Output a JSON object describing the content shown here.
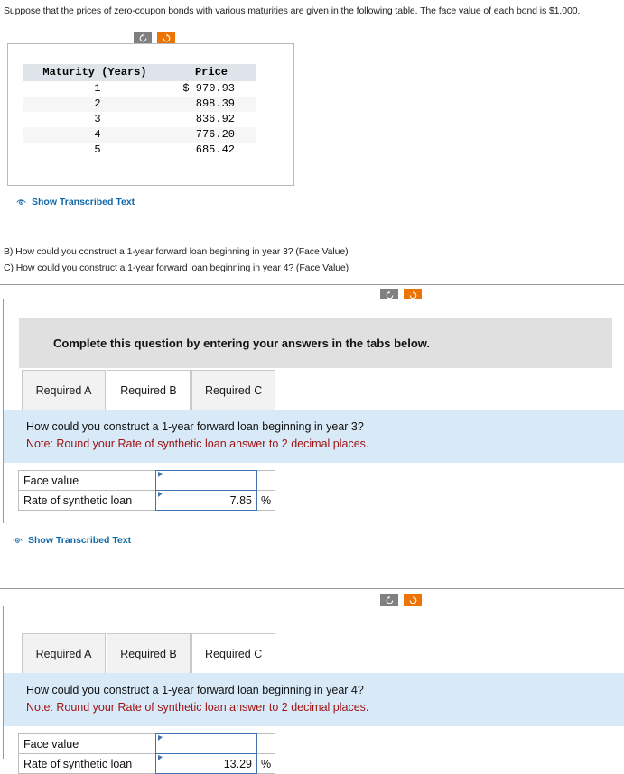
{
  "intro": {
    "text": "Suppose that the prices of zero-coupon bonds with various maturities are given in the following table. The face value of each bond is $1,000."
  },
  "toolbar": {
    "rotate_left_label": "rotate-left",
    "rotate_right_label": "rotate-right"
  },
  "bond_table": {
    "headers": [
      "Maturity (Years)",
      "Price"
    ],
    "rows": [
      {
        "maturity": "1",
        "price": "$ 970.93"
      },
      {
        "maturity": "2",
        "price": "898.39"
      },
      {
        "maturity": "3",
        "price": "836.92"
      },
      {
        "maturity": "4",
        "price": "776.20"
      },
      {
        "maturity": "5",
        "price": "685.42"
      }
    ]
  },
  "transcribed_link": {
    "label": "Show Transcribed Text"
  },
  "questions": {
    "b": "B) How could you construct a 1-year forward loan beginning in year 3? (Face Value)",
    "c": "C) How could you construct a 1-year forward loan beginning in year 4? (Face Value)"
  },
  "panel_b": {
    "banner": "Complete this question by entering your answers in the tabs below.",
    "tabs": [
      {
        "label": "Required A",
        "active": false
      },
      {
        "label": "Required B",
        "active": true
      },
      {
        "label": "Required C",
        "active": false
      }
    ],
    "question": "How could you construct a 1-year forward loan beginning in year 3?",
    "note": "Note: Round your Rate of synthetic loan answer to 2 decimal places.",
    "answers": [
      {
        "label": "Face value",
        "value": "",
        "unit": ""
      },
      {
        "label": "Rate of synthetic loan",
        "value": "7.85",
        "unit": "%"
      }
    ]
  },
  "panel_c": {
    "tabs": [
      {
        "label": "Required A",
        "active": false
      },
      {
        "label": "Required B",
        "active": false
      },
      {
        "label": "Required C",
        "active": true
      }
    ],
    "question": "How could you construct a 1-year forward loan beginning in year 4?",
    "note": "Note: Round your Rate of synthetic loan answer to 2 decimal places.",
    "answers": [
      {
        "label": "Face value",
        "value": "",
        "unit": ""
      },
      {
        "label": "Rate of synthetic loan",
        "value": "13.29",
        "unit": "%"
      }
    ]
  },
  "colors": {
    "accent_orange": "#ec7405",
    "toolbar_gray": "#808080",
    "link_blue": "#1268a8",
    "question_blue_bg": "#d8eaf8",
    "note_red": "#9d1111",
    "banner_gray": "#e0e0e0",
    "input_border_blue": "#4472b0",
    "table_header_bg": "#dfe3ea"
  }
}
